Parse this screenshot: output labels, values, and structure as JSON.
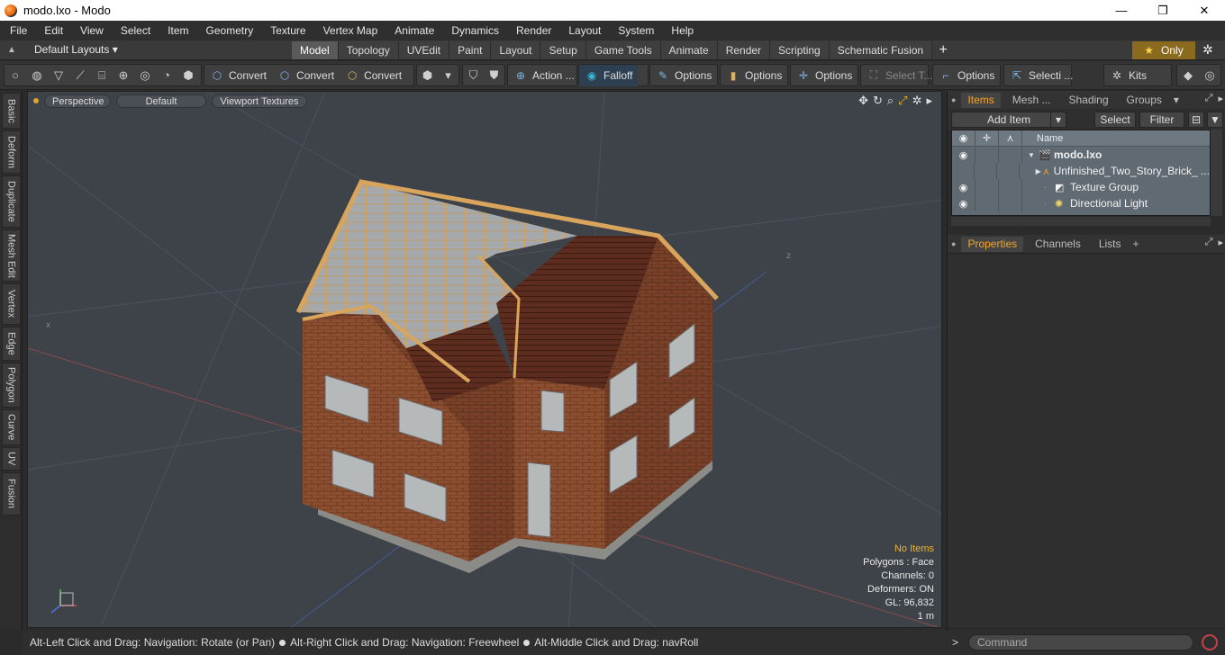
{
  "window": {
    "title": "modo.lxo - Modo",
    "min": "—",
    "max": "❐",
    "close": "✕"
  },
  "menubar": [
    "File",
    "Edit",
    "View",
    "Select",
    "Item",
    "Geometry",
    "Texture",
    "Vertex Map",
    "Animate",
    "Dynamics",
    "Render",
    "Layout",
    "System",
    "Help"
  ],
  "layouts": {
    "label": "Default Layouts ▾"
  },
  "layout_tabs": [
    {
      "label": "Model",
      "active": true
    },
    {
      "label": "Topology"
    },
    {
      "label": "UVEdit"
    },
    {
      "label": "Paint"
    },
    {
      "label": "Layout"
    },
    {
      "label": "Setup"
    },
    {
      "label": "Game Tools"
    },
    {
      "label": "Animate"
    },
    {
      "label": "Render"
    },
    {
      "label": "Scripting"
    },
    {
      "label": "Schematic Fusion"
    }
  ],
  "only_btn": "Only",
  "toolbar": {
    "convert1": "Convert",
    "convert2": "Convert",
    "convert3": "Convert",
    "action": "Action ...",
    "falloff": "Falloff",
    "options1": "Options",
    "options2": "Options",
    "options3": "Options",
    "select_t": "Select T...",
    "options4": "Options",
    "selecti": "Selecti ...",
    "kits": "Kits"
  },
  "left_tabs": [
    "Basic",
    "Deform",
    "Duplicate",
    "Mesh Edit",
    "Vertex",
    "Edge",
    "Polygon",
    "Curve",
    "UV",
    "Fusion"
  ],
  "viewport": {
    "perspective": "Perspective",
    "default": "Default",
    "textures": "Viewport Textures",
    "stats": {
      "no_items": "No Items",
      "polygons": "Polygons : Face",
      "channels": "Channels: 0",
      "deformers": "Deformers: ON",
      "gl": "GL: 96,832",
      "scale": "1 m"
    }
  },
  "status": {
    "part1": "Alt-Left Click and Drag: Navigation: Rotate (or Pan)",
    "part2": "Alt-Right Click and Drag: Navigation: Freewheel",
    "part3": "Alt-Middle Click and Drag: navRoll"
  },
  "items_panel": {
    "tabs": [
      "Items",
      "Mesh ...",
      "Shading",
      "Groups"
    ],
    "add_item": "Add Item",
    "select": "Select",
    "filter": "Filter",
    "col_name": "Name",
    "rows": [
      {
        "name": "modo.lxo",
        "bold": true
      },
      {
        "name": "Unfinished_Two_Story_Brick_ ..."
      },
      {
        "name": "Texture Group"
      },
      {
        "name": "Directional Light"
      }
    ]
  },
  "props_panel": {
    "tabs": [
      "Properties",
      "Channels",
      "Lists"
    ]
  },
  "command": {
    "placeholder": "Command",
    "prompt": ">"
  },
  "colors": {
    "accent": "#f3a52a",
    "viewport_bg": "#3d4349",
    "brick": "#8a4a2c",
    "roof_tile": "#5a2a1e",
    "timber": "#d9a45b"
  }
}
